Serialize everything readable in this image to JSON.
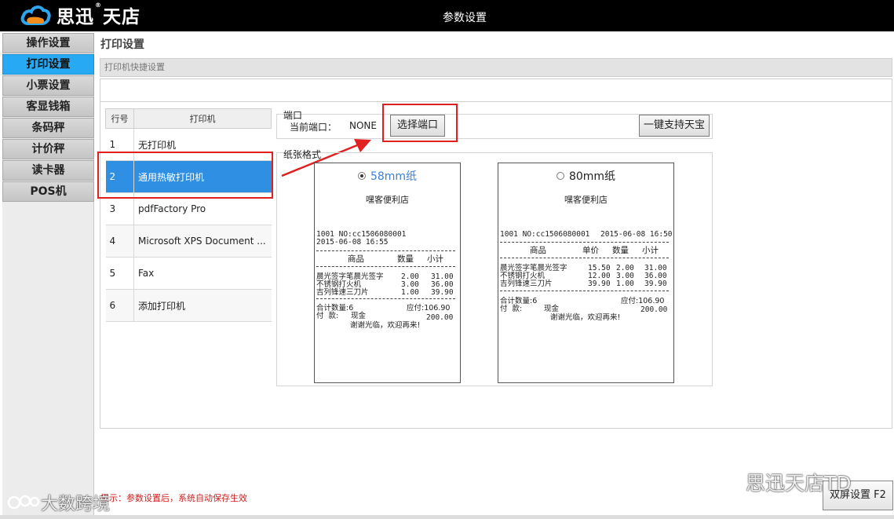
{
  "app": {
    "brand": "思迅",
    "brand_suffix": "天店",
    "window_title": "参数设置"
  },
  "sidebar": {
    "items": [
      {
        "label": "操作设置",
        "active": false
      },
      {
        "label": "打印设置",
        "active": true
      },
      {
        "label": "小票设置",
        "active": false
      },
      {
        "label": "客显钱箱",
        "active": false
      },
      {
        "label": "条码秤",
        "active": false
      },
      {
        "label": "计价秤",
        "active": false
      },
      {
        "label": "读卡器",
        "active": false
      },
      {
        "label": "POS机",
        "active": false
      }
    ]
  },
  "page": {
    "title": "打印设置",
    "subheader": "打印机快捷设置"
  },
  "printer_table": {
    "headers": [
      "行号",
      "打印机"
    ],
    "rows": [
      {
        "num": "1",
        "name": "无打印机"
      },
      {
        "num": "2",
        "name": "通用热敏打印机",
        "selected": true
      },
      {
        "num": "3",
        "name": "pdfFactory Pro"
      },
      {
        "num": "4",
        "name": "Microsoft XPS Document ..."
      },
      {
        "num": "5",
        "name": "Fax"
      },
      {
        "num": "6",
        "name": "添加打印机"
      }
    ]
  },
  "port": {
    "legend": "端口",
    "current_label": "当前端口：",
    "current_value": "NONE",
    "select_button": "选择端口",
    "support_button": "一键支持天宝"
  },
  "paper": {
    "legend": "纸张格式",
    "option_58": {
      "label": "58mm纸",
      "checked": true
    },
    "option_80": {
      "label": "80mm纸",
      "checked": false
    },
    "shop_name": "嘿客便利店",
    "receipt_58": {
      "line1": "1001 NO:cc1506080001",
      "line2": "2015-06-08 16:55",
      "col_item": "商品",
      "col_qty": "数量",
      "col_subtotal": "小计",
      "items": [
        {
          "name": "晨光签字笔晨光签字",
          "qty": "2.00",
          "subtotal": "31.00"
        },
        {
          "name": "不锈钢打火机",
          "qty": "3.00",
          "subtotal": "36.00"
        },
        {
          "name": "吉列锋速三刀片",
          "qty": "1.00",
          "subtotal": "39.90"
        }
      ],
      "total_qty": "合计数量:6",
      "due": "应付:106.90",
      "pay_label": "付  款:",
      "pay_method": "现金",
      "paid": "200.00",
      "thanks": "谢谢光临，欢迎再来!"
    },
    "receipt_80": {
      "line1": "1001 NO:cc1506080001",
      "datetime": "2015-06-08 16:50",
      "col_item": "商品",
      "col_price": "单价",
      "col_qty": "数量",
      "col_subtotal": "小计",
      "items": [
        {
          "name": "晨光签字笔晨光签字",
          "price": "15.50",
          "qty": "2.00",
          "subtotal": "31.00"
        },
        {
          "name": "不锈钢打火机",
          "price": "12.00",
          "qty": "3.00",
          "subtotal": "36.00"
        },
        {
          "name": "吉列锋速三刀片",
          "price": "39.90",
          "qty": "1.00",
          "subtotal": "39.90"
        }
      ],
      "total_qty": "合计数量:6",
      "due": "应付:106.90",
      "pay_label": "付  款:",
      "pay_method": "现金",
      "paid": "200.00",
      "thanks": "谢谢光临，欢迎再来!"
    }
  },
  "footer": {
    "tip": "提示：参数设置后，系统自动保存生效",
    "dual_screen_button": "双屏设置 F2"
  },
  "watermarks": {
    "right": "思迅天店TD",
    "left": "大数跨境"
  },
  "colors": {
    "active_blue": "#27a9f3",
    "selected_row": "#2e8fe3",
    "highlight_red": "#e02020",
    "tip_red": "#d02020"
  }
}
